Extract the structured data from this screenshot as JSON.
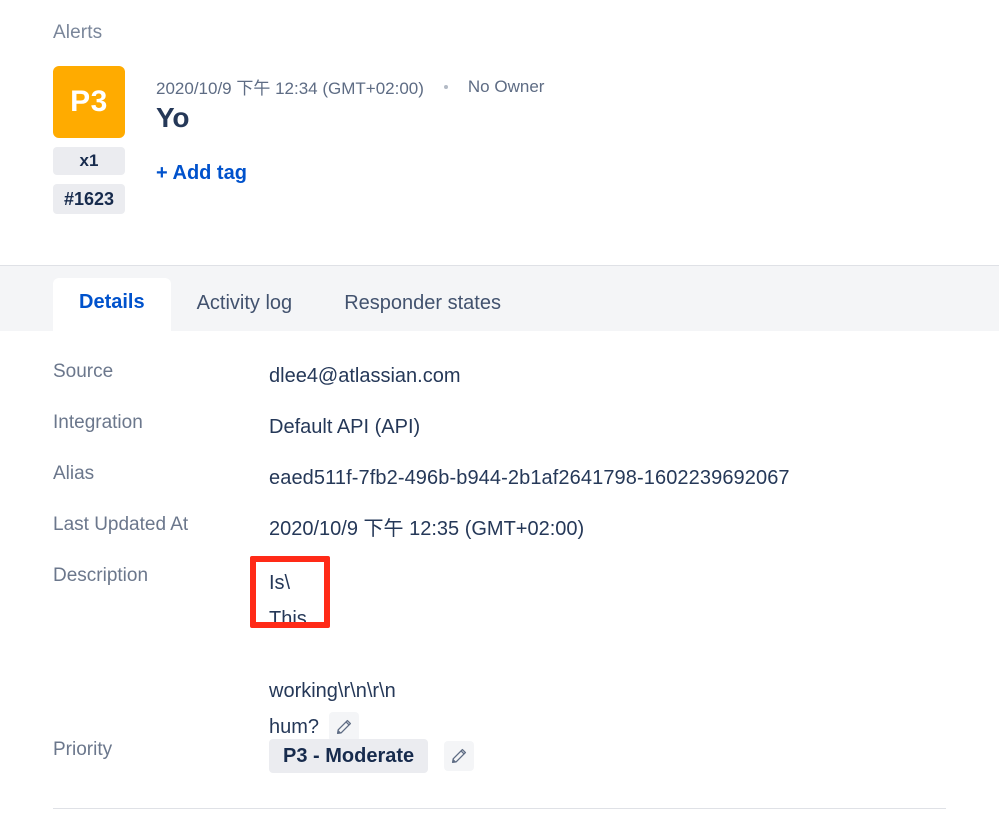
{
  "breadcrumb": {
    "label": "Alerts"
  },
  "alert": {
    "priority_code": "P3",
    "priority_color": "#FFAB00",
    "count_badge": "x1",
    "id_badge": "#1623",
    "timestamp": "2020/10/9 下午 12:34 (GMT+02:00)",
    "owner": "No Owner",
    "title": "Yo",
    "add_tag_label": "+ Add tag"
  },
  "tabs": [
    {
      "label": "Details",
      "active": true
    },
    {
      "label": "Activity log",
      "active": false
    },
    {
      "label": "Responder states",
      "active": false
    }
  ],
  "details": {
    "source": {
      "label": "Source",
      "value": "dlee4@atlassian.com"
    },
    "integration": {
      "label": "Integration",
      "value": "Default API (API)"
    },
    "alias": {
      "label": "Alias",
      "value": "eaed511f-7fb2-496b-b944-2b1af2641798-1602239692067"
    },
    "last_updated": {
      "label": "Last Updated At",
      "value": "2020/10/9 下午 12:35 (GMT+02:00)"
    },
    "description": {
      "label": "Description",
      "line1": "Is\\",
      "line2": "This",
      "line3": "working\\r\\n\\r\\n",
      "line4": "hum?",
      "edit_icon": "pencil-icon"
    },
    "priority": {
      "label": "Priority",
      "value": "P3 - Moderate",
      "edit_icon": "pencil-icon"
    }
  },
  "annotation": {
    "color": "#FF2A17",
    "target": "description-first-lines"
  }
}
